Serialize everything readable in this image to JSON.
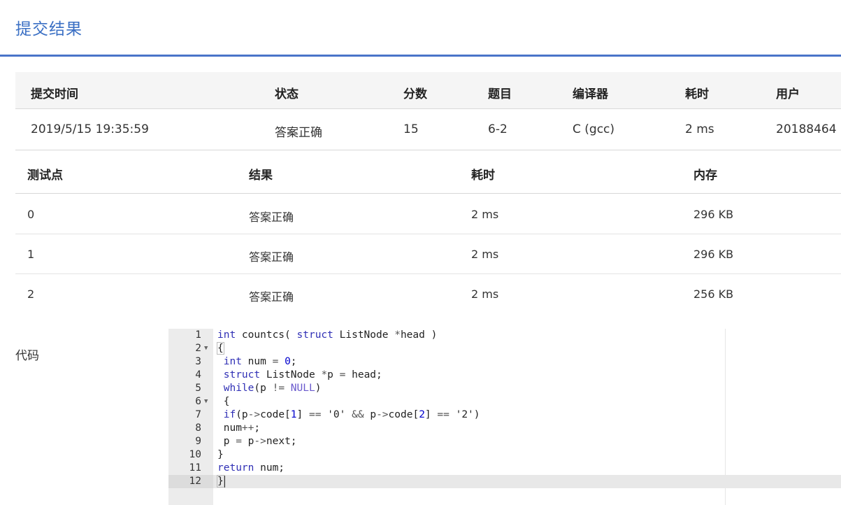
{
  "page": {
    "title": "提交结果"
  },
  "colors": {
    "accent": "#4a74c9",
    "ok": "#e2483c",
    "link": "#1f5ea8"
  },
  "summary": {
    "headers": [
      "提交时间",
      "状态",
      "分数",
      "题目",
      "编译器",
      "耗时",
      "用户"
    ],
    "row": {
      "time": "2019/5/15 19:35:59",
      "status": "答案正确",
      "score": "15",
      "problem": "6-2",
      "compiler": "C (gcc)",
      "duration": "2 ms",
      "user": "20188464"
    }
  },
  "testpoints": {
    "headers": [
      "测试点",
      "结果",
      "耗时",
      "内存"
    ],
    "rows": [
      {
        "id": "0",
        "result": "答案正确",
        "time": "2 ms",
        "memory": "296 KB"
      },
      {
        "id": "1",
        "result": "答案正确",
        "time": "2 ms",
        "memory": "296 KB"
      },
      {
        "id": "2",
        "result": "答案正确",
        "time": "2 ms",
        "memory": "256 KB"
      }
    ]
  },
  "code": {
    "label": "代码",
    "line_numbers": [
      "1",
      "2",
      "3",
      "4",
      "5",
      "6",
      "7",
      "8",
      "9",
      "10",
      "11",
      "12"
    ],
    "lines": [
      "int countcs( struct ListNode *head )",
      "{",
      " int num = 0;",
      " struct ListNode *p = head;",
      " while(p != NULL)",
      " {",
      " if(p->code[1] == '0' && p->code[2] == '2')",
      " num++;",
      " p = p->next;",
      "}",
      "return num;",
      "}"
    ],
    "active_line": "12",
    "fold_icon": "chevron-down-icon"
  }
}
